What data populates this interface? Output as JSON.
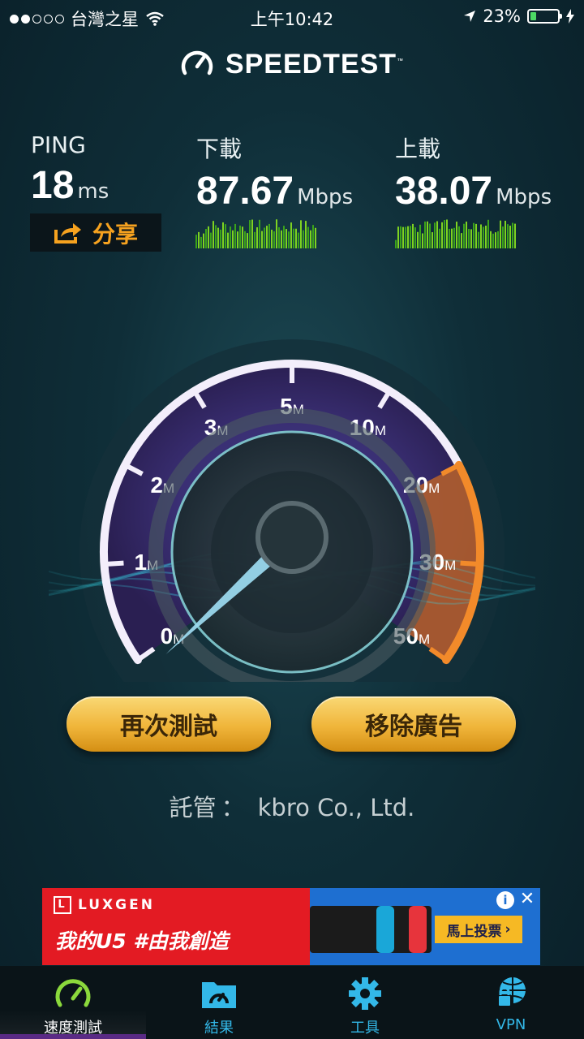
{
  "status_bar": {
    "carrier": "台灣之星",
    "time": "上午10:42",
    "battery": "23%",
    "battery_level": 0.23
  },
  "header": {
    "title": "SPEEDTEST",
    "trademark": "™"
  },
  "stats": {
    "ping": {
      "label": "PING",
      "value": "18",
      "unit": "ms"
    },
    "download": {
      "label": "下載",
      "value": "87.67",
      "unit": "Mbps"
    },
    "upload": {
      "label": "上載",
      "value": "38.07",
      "unit": "Mbps"
    }
  },
  "share_label": "分享",
  "gauge": {
    "ticks": [
      {
        "num": "0",
        "unit": "M"
      },
      {
        "num": "1",
        "unit": "M"
      },
      {
        "num": "2",
        "unit": "M"
      },
      {
        "num": "3",
        "unit": "M"
      },
      {
        "num": "5",
        "unit": "M"
      },
      {
        "num": "10",
        "unit": "M"
      },
      {
        "num": "20",
        "unit": "M"
      },
      {
        "num": "30",
        "unit": "M"
      },
      {
        "num": "50",
        "unit": "M"
      }
    ],
    "needle_value_mbps": 0
  },
  "buttons": {
    "retest": "再次測試",
    "remove_ads": "移除廣告"
  },
  "host": {
    "label": "託管",
    "colon": "：",
    "name": "kbro Co., Ltd."
  },
  "ad": {
    "brand": "LUXGEN",
    "slogan": "我的U5 #由我創造",
    "cta": "馬上投票",
    "info": "i",
    "close": "✕"
  },
  "tabs": [
    {
      "label": "速度測試",
      "icon": "gauge-icon",
      "active": true
    },
    {
      "label": "結果",
      "icon": "folder-gauge-icon",
      "active": false
    },
    {
      "label": "工具",
      "icon": "gear-icon",
      "active": false
    },
    {
      "label": "VPN",
      "icon": "globe-lock-icon",
      "active": false
    }
  ],
  "colors": {
    "accent": "#f0b53a",
    "tab_accent": "#33b8e8",
    "active_icon": "#8bd93c",
    "speed_orange": "#f28a2a"
  }
}
